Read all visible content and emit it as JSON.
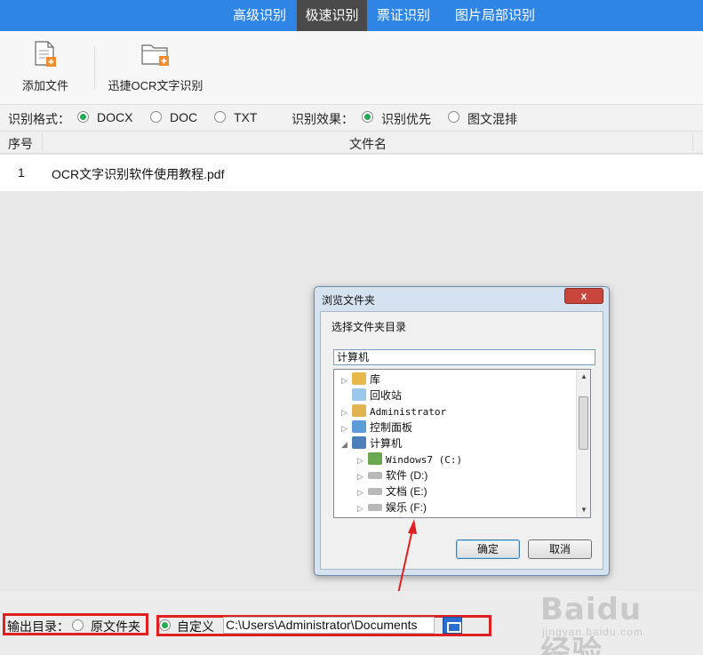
{
  "tabs": [
    {
      "label": "高级识别",
      "active": false
    },
    {
      "label": "极速识别",
      "active": true
    },
    {
      "label": "票证识别",
      "active": false
    },
    {
      "label": "图片局部识别",
      "active": false
    }
  ],
  "toolbar": {
    "add_file_label": "添加文件",
    "ocr_label": "迅捷OCR文字识别"
  },
  "options": {
    "format_label": "识别格式：",
    "formats": [
      {
        "label": "DOCX",
        "selected": true
      },
      {
        "label": "DOC",
        "selected": false
      },
      {
        "label": "TXT",
        "selected": false
      }
    ],
    "effect_label": "识别效果：",
    "effects": [
      {
        "label": "识别优先",
        "selected": true
      },
      {
        "label": "图文混排",
        "selected": false
      }
    ]
  },
  "table": {
    "headers": [
      "序号",
      "文件名"
    ],
    "rows": [
      {
        "index": "1",
        "filename": "OCR文字识别软件使用教程.pdf"
      }
    ]
  },
  "dialog": {
    "title": "浏览文件夹",
    "close": "x",
    "prompt": "选择文件夹目录",
    "path_value": "计算机",
    "tree": [
      {
        "label": "库",
        "icon": "library-icon"
      },
      {
        "label": "回收站",
        "icon": "recycle-bin-icon"
      },
      {
        "label": "Administrator",
        "icon": "user-folder-icon"
      },
      {
        "label": "控制面板",
        "icon": "control-panel-icon"
      },
      {
        "label": "计算机",
        "icon": "computer-icon"
      },
      {
        "label": "Windows7 (C:)",
        "icon": "windows-drive-icon"
      },
      {
        "label": "软件 (D:)",
        "icon": "drive-icon"
      },
      {
        "label": "文档 (E:)",
        "icon": "drive-icon"
      },
      {
        "label": "娱乐 (F:)",
        "icon": "drive-icon"
      }
    ],
    "ok_label": "确定",
    "cancel_label": "取消"
  },
  "output": {
    "label": "输出目录：",
    "original_label": "原文件夹",
    "custom_label": "自定义",
    "path": "C:\\Users\\Administrator\\Documents"
  },
  "watermark": {
    "brand": "Baidu 经验",
    "site": "jingyan.baidu.com"
  },
  "colors": {
    "topbar": "#2e85e6",
    "active_tab": "#4a4a4a",
    "highlight": "#e02020",
    "radio_selected": "#22aa55"
  }
}
